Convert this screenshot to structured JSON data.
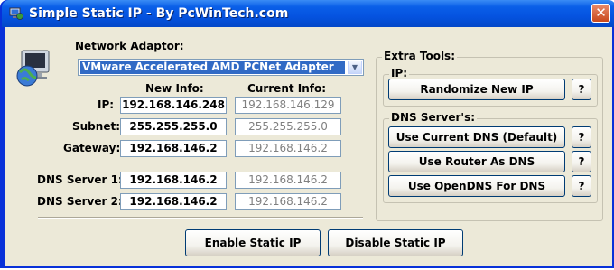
{
  "window": {
    "title": "Simple Static IP - By PcWinTech.com"
  },
  "colors": {
    "titlebar": "#0553e0",
    "selection": "#316ac5",
    "readonly_text": "#808080",
    "close": "#c9481c"
  },
  "icons": {
    "app": "network-computer-icon",
    "adaptor": "globe-computer-icon",
    "close": "close-icon"
  },
  "adaptor": {
    "label": "Network Adaptor:",
    "selected": "VMware Accelerated AMD PCNet Adapter"
  },
  "columns": {
    "new": "New Info:",
    "current": "Current Info:"
  },
  "rows": [
    {
      "label": "IP:",
      "new": "192.168.146.248",
      "current": "192.168.146.129"
    },
    {
      "label": "Subnet:",
      "new": "255.255.255.0",
      "current": "255.255.255.0"
    },
    {
      "label": "Gateway:",
      "new": "192.168.146.2",
      "current": "192.168.146.2"
    },
    {
      "label": "DNS Server 1:",
      "new": "192.168.146.2",
      "current": "192.168.146.2"
    },
    {
      "label": "DNS Server 2:",
      "new": "192.168.146.2",
      "current": "192.168.146.2"
    }
  ],
  "extra": {
    "title": "Extra Tools:",
    "ip_group": "IP:",
    "randomize": "Randomize New IP",
    "dns_group": "DNS Server's:",
    "dns_current": "Use Current DNS (Default)",
    "dns_router": "Use Router As DNS",
    "dns_opendns": "Use OpenDNS For DNS",
    "help": "?"
  },
  "actions": {
    "enable": "Enable Static IP",
    "disable": "Disable Static IP"
  }
}
